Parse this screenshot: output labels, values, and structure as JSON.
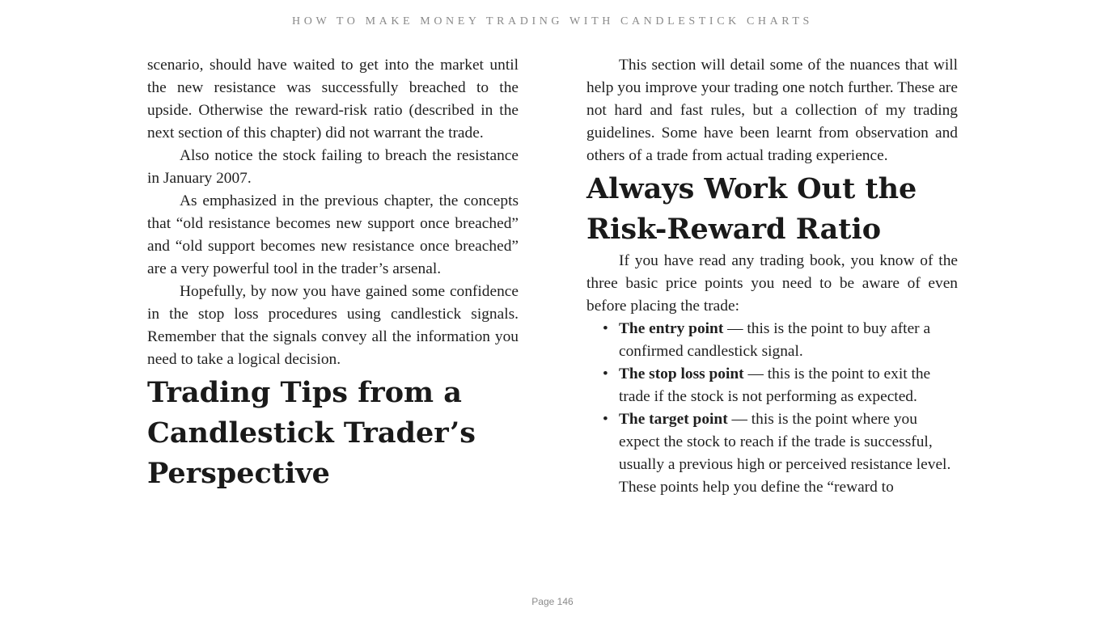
{
  "header": {
    "running_title": "HOW TO MAKE MONEY TRADING WITH CANDLESTICK CHARTS"
  },
  "left_column": {
    "paragraphs": [
      "scenario, should have waited to get into the market until the new resistance was successfully breached to the upside. Otherwise the reward-risk ratio (described in the next section of this chapter) did not warrant the trade.",
      "Also notice the stock failing to breach the resistance in January 2007.",
      "As emphasized in the previous chapter, the concepts that “old resistance becomes new support once breached” and “old support becomes new resistance once breached” are a very powerful tool in the trader’s arsenal.",
      "Hopefully, by now you have gained some confidence in the stop loss procedures using candlestick signals. Remember that the signals convey all the information you need to take a logical decision."
    ],
    "heading": "Trading Tips from a Candlestick Trader’s Perspective"
  },
  "right_column": {
    "intro": "This section will detail some of the nuances that will help you improve your trading one notch further. These are not hard and fast rules, but a collection of my trading guidelines. Some have been learnt from observation and others of a trade from actual trading experience.",
    "heading": "Always Work Out the Risk-Reward Ratio",
    "lead": "If you have read any trading book, you know of the three basic price points you need to be aware of even before placing the trade:",
    "bullets": [
      {
        "term": "The entry point",
        "text": " — this is the point to buy after a confirmed candlestick signal."
      },
      {
        "term": "The stop loss point",
        "text": " — this is the point to exit the trade if the stock is not performing as expected."
      },
      {
        "term": "The target point",
        "text": " — this is the point where you expect the stock to reach if the trade is successful, usually a previous high or perceived resistance level."
      }
    ],
    "closing": "These points help you define the “reward to"
  },
  "footer": {
    "page_label": "Page 146"
  }
}
